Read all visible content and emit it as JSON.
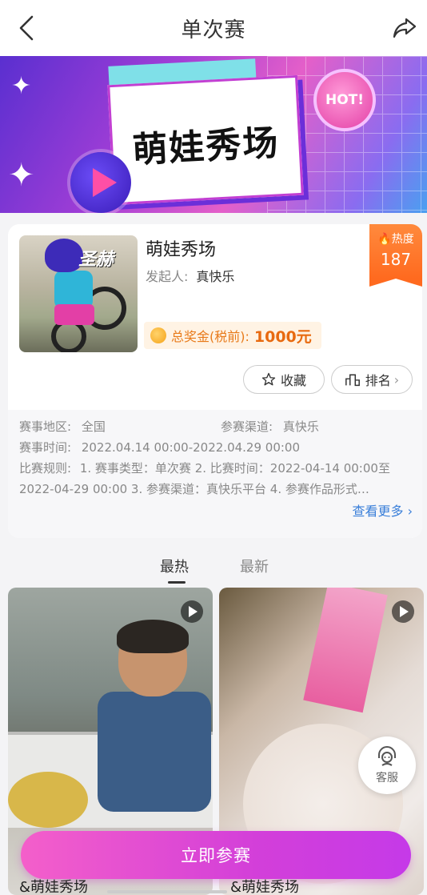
{
  "header": {
    "title": "单次赛",
    "back_icon": "back-arrow-icon",
    "share_icon": "share-icon"
  },
  "banner": {
    "title": "萌娃秀场",
    "badge": "HOT!"
  },
  "event": {
    "title": "萌娃秀场",
    "organizer_label": "发起人:",
    "organizer_name": "真快乐",
    "heat_label": "热度",
    "heat_value": "187",
    "prize_label": "总奖金(税前):",
    "prize_value": "1000元",
    "thumb_brand": "圣赫"
  },
  "actions": {
    "favorite_label": "收藏",
    "rank_label": "排名"
  },
  "details": {
    "region_label": "赛事地区:",
    "region_value": "全国",
    "channel_label": "参赛渠道:",
    "channel_value": "真快乐",
    "time_label": "赛事时间:",
    "time_value": "2022.04.14 00:00-2022.04.29 00:00",
    "rules_label": "比赛规则:",
    "rules_value": "1. 赛事类型：单次赛 2. 比赛时间：2022-04-14 00:00至 2022-04-29 00:00 3. 参赛渠道：真快乐平台 4. 参赛作品形式…",
    "more_label": "查看更多"
  },
  "tabs": [
    {
      "label": "最热",
      "active": true
    },
    {
      "label": "最新",
      "active": false
    }
  ],
  "videos": [
    {
      "title": "&萌娃秀场"
    },
    {
      "title": "&萌娃秀场"
    }
  ],
  "service": {
    "label": "客服"
  },
  "join_button": {
    "label": "立即参赛"
  },
  "colors": {
    "accent": "#d33fd9",
    "heat": "#ff6a1f",
    "prize": "#e86a10",
    "link": "#3a7fd9"
  }
}
